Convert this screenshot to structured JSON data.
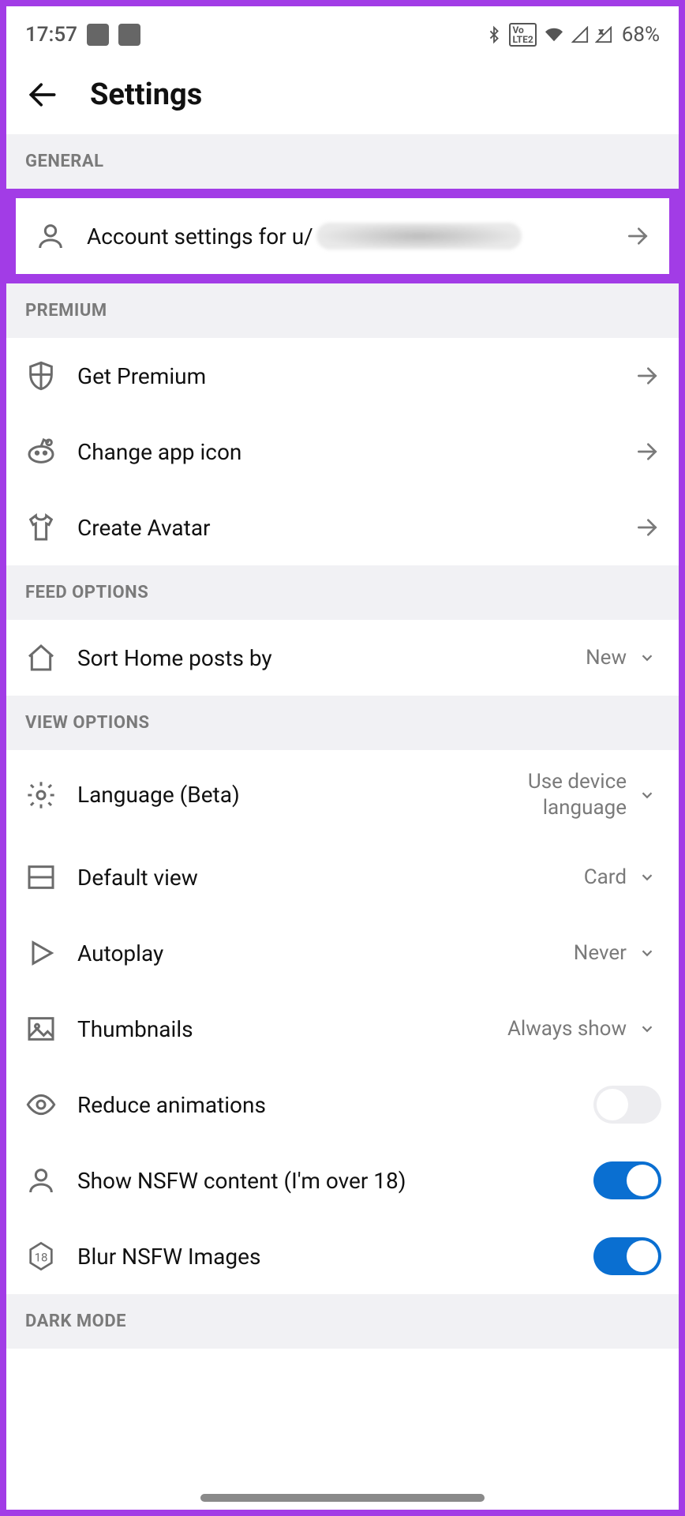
{
  "status": {
    "time": "17:57",
    "battery": "68%"
  },
  "header": {
    "title": "Settings"
  },
  "sections": {
    "general": {
      "title": "GENERAL"
    },
    "premium": {
      "title": "PREMIUM"
    },
    "feed": {
      "title": "FEED OPTIONS"
    },
    "view": {
      "title": "VIEW OPTIONS"
    },
    "dark": {
      "title": "DARK MODE"
    }
  },
  "rows": {
    "account": {
      "label": "Account settings for u/"
    },
    "get_premium": {
      "label": "Get Premium"
    },
    "app_icon": {
      "label": "Change app icon"
    },
    "avatar": {
      "label": "Create Avatar"
    },
    "sort_home": {
      "label": "Sort Home posts by",
      "value": "New"
    },
    "language": {
      "label": "Language (Beta)",
      "value": "Use device language"
    },
    "default_view": {
      "label": "Default view",
      "value": "Card"
    },
    "autoplay": {
      "label": "Autoplay",
      "value": "Never"
    },
    "thumbnails": {
      "label": "Thumbnails",
      "value": "Always show"
    },
    "reduce_anim": {
      "label": "Reduce animations",
      "on": false
    },
    "nsfw": {
      "label": "Show NSFW content (I'm over 18)",
      "on": true
    },
    "blur_nsfw": {
      "label": "Blur NSFW Images",
      "on": true
    }
  }
}
